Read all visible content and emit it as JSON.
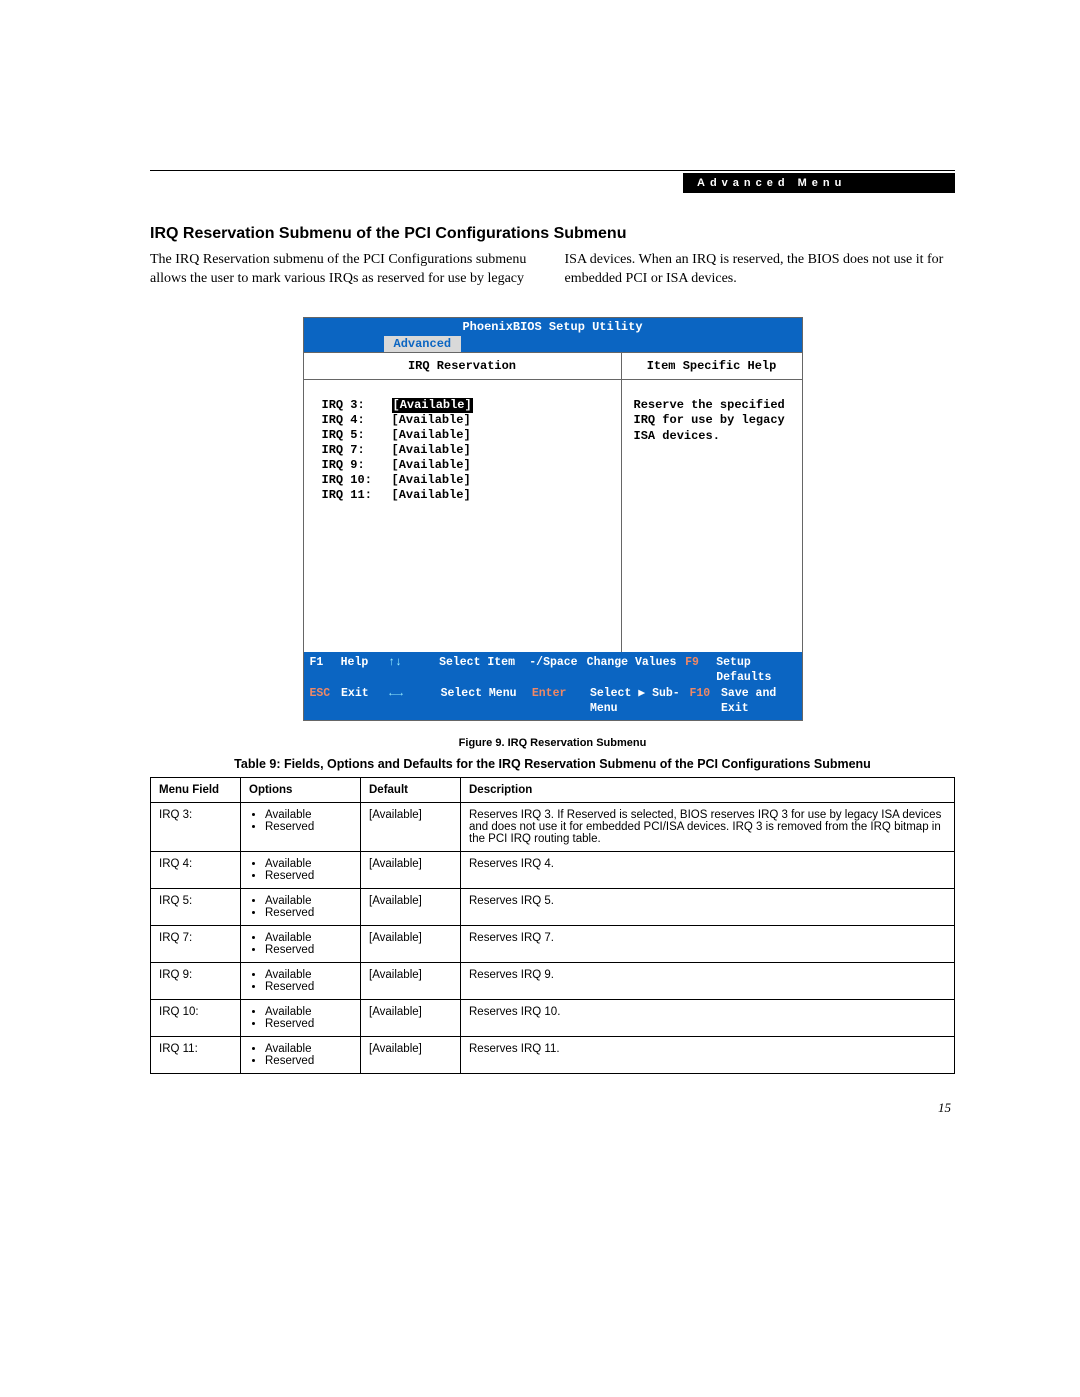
{
  "header": {
    "tag": "Advanced Menu"
  },
  "section_title": "IRQ Reservation Submenu of the PCI Configurations Submenu",
  "intro": "The IRQ Reservation submenu of the PCI Configurations submenu allows the user to mark various IRQs as reserved for use by legacy ISA devices. When an IRQ is reserved, the BIOS does not use it for embedded PCI or ISA devices.",
  "bios": {
    "title": "PhoenixBIOS Setup Utility",
    "tab": "Advanced",
    "left_title": "IRQ Reservation",
    "right_title": "Item Specific Help",
    "help_text": "Reserve the specified IRQ for use by legacy ISA devices.",
    "irqs": [
      {
        "label": "IRQ 3:",
        "value": "[Available]",
        "selected": true
      },
      {
        "label": "IRQ 4:",
        "value": "[Available]",
        "selected": false
      },
      {
        "label": "IRQ 5:",
        "value": "[Available]",
        "selected": false
      },
      {
        "label": "IRQ 7:",
        "value": "[Available]",
        "selected": false
      },
      {
        "label": "IRQ 9:",
        "value": "[Available]",
        "selected": false
      },
      {
        "label": "IRQ 10:",
        "value": "[Available]",
        "selected": false
      },
      {
        "label": "IRQ 11:",
        "value": "[Available]",
        "selected": false
      }
    ],
    "footer": {
      "f1": "F1",
      "help": "Help",
      "arrows_v": "↑↓",
      "select_item": "Select Item",
      "minus_space": "-/Space",
      "change_values": "Change Values",
      "f9": "F9",
      "setup_defaults": "Setup Defaults",
      "esc": "ESC",
      "exit": "Exit",
      "arrows_h": "←→",
      "select_menu": "Select Menu",
      "enter": "Enter",
      "select_sub": "Select ▶ Sub-Menu",
      "f10": "F10",
      "save_exit": "Save and Exit"
    }
  },
  "figure_caption": "Figure 9.  IRQ Reservation Submenu",
  "table_caption": "Table 9: Fields, Options and Defaults for the IRQ Reservation Submenu of the PCI Configurations Submenu",
  "table": {
    "headers": {
      "mf": "Menu Field",
      "op": "Options",
      "df": "Default",
      "desc": "Description"
    },
    "rows": [
      {
        "mf": "IRQ 3:",
        "op": [
          "Available",
          "Reserved"
        ],
        "df": "[Available]",
        "desc": "Reserves IRQ 3. If Reserved is selected, BIOS reserves IRQ 3 for use by legacy ISA devices and does not use it for embedded PCI/ISA devices. IRQ 3 is removed from the IRQ bitmap in the PCI IRQ routing table."
      },
      {
        "mf": "IRQ 4:",
        "op": [
          "Available",
          "Reserved"
        ],
        "df": "[Available]",
        "desc": "Reserves IRQ 4."
      },
      {
        "mf": "IRQ 5:",
        "op": [
          "Available",
          "Reserved"
        ],
        "df": "[Available]",
        "desc": "Reserves IRQ 5."
      },
      {
        "mf": "IRQ 7:",
        "op": [
          "Available",
          "Reserved"
        ],
        "df": "[Available]",
        "desc": "Reserves IRQ 7."
      },
      {
        "mf": "IRQ 9:",
        "op": [
          "Available",
          "Reserved"
        ],
        "df": "[Available]",
        "desc": "Reserves IRQ 9."
      },
      {
        "mf": "IRQ 10:",
        "op": [
          "Available",
          "Reserved"
        ],
        "df": "[Available]",
        "desc": "Reserves IRQ 10."
      },
      {
        "mf": "IRQ 11:",
        "op": [
          "Available",
          "Reserved"
        ],
        "df": "[Available]",
        "desc": "Reserves IRQ 11."
      }
    ]
  },
  "page_number": "15"
}
